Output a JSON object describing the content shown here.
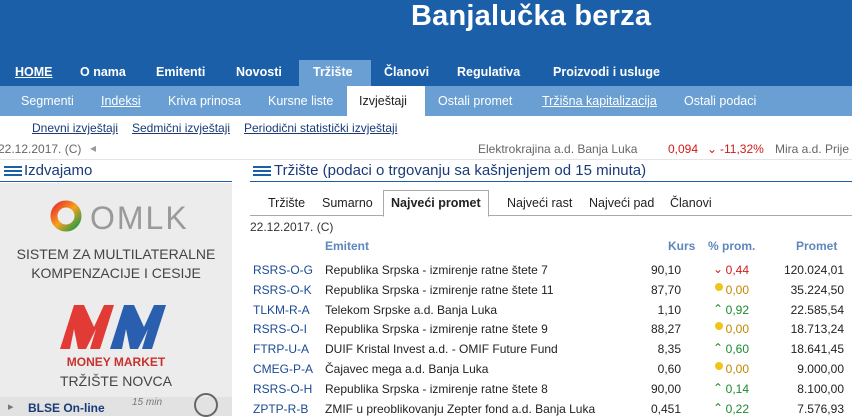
{
  "site": {
    "title": "Banjalučka berza"
  },
  "main_nav": [
    "HOME",
    "O nama",
    "Emitenti",
    "Novosti",
    "Tržište",
    "Članovi",
    "Regulativa",
    "Proizvodi i usluge"
  ],
  "sub_nav": [
    "Segmenti",
    "Indeksi",
    "Kriva prinosa",
    "Kursne liste",
    "Izvještaji",
    "Ostali promet",
    "Tržišna kapitalizacija",
    "Ostali podaci"
  ],
  "tertiary_nav": [
    "Dnevni izvještaji",
    "Sedmični izvještaji",
    "Periodični statistički izvještaji"
  ],
  "ticker": {
    "date": "22.12.2017. (C)",
    "item1_name": "Elektrokrajina a.d. Banja Luka",
    "item1_price": "0,094",
    "item1_change": "-11,32%",
    "item2_name": "Mira a.d. Prije"
  },
  "sidebar": {
    "title": "Izdvajamo",
    "omlk_logo": "OMLK",
    "omlk_text": "SISTEM ZA MULTILATERALNE KOMPENZACIJE I CESIJE",
    "mm_logo": "MONEY MARKET",
    "mm_caption": "TRŽIŠTE NOVCA",
    "bottom_label": "BLSE On-line",
    "bottom_note": "15 min"
  },
  "market": {
    "title": "Tržište (podaci o trgovanju sa kašnjenjem od 15 minuta)",
    "tabs": [
      "Tržište",
      "Sumarno",
      "Najveći promet",
      "Najveći rast",
      "Najveći pad",
      "Članovi"
    ],
    "date": "22.12.2017. (C)",
    "columns": {
      "emitent": "Emitent",
      "kurs": "Kurs",
      "pct": "% prom.",
      "promet": "Promet"
    },
    "rows": [
      {
        "code": "RSRS-O-G",
        "name": "Republika Srpska - izmirenje ratne štete 7",
        "kurs": "90,10",
        "trend": "down",
        "pct": "0,44",
        "promet": "120.024,01"
      },
      {
        "code": "RSRS-O-K",
        "name": "Republika Srpska - izmirenje ratne štete 11",
        "kurs": "87,70",
        "trend": "flat",
        "pct": "0,00",
        "promet": "35.224,50"
      },
      {
        "code": "TLKM-R-A",
        "name": "Telekom Srpske a.d. Banja Luka",
        "kurs": "1,10",
        "trend": "up",
        "pct": "0,92",
        "promet": "22.585,54"
      },
      {
        "code": "RSRS-O-I",
        "name": "Republika Srpska - izmirenje ratne štete 9",
        "kurs": "88,27",
        "trend": "flat",
        "pct": "0,00",
        "promet": "18.713,24"
      },
      {
        "code": "FTRP-U-A",
        "name": "DUIF Kristal Invest a.d. - OMIF Future Fund",
        "kurs": "8,35",
        "trend": "up",
        "pct": "0,60",
        "promet": "18.641,45"
      },
      {
        "code": "CMEG-P-A",
        "name": "Čajavec mega a.d. Banja Luka",
        "kurs": "0,60",
        "trend": "flat",
        "pct": "0,00",
        "promet": "9.000,00"
      },
      {
        "code": "RSRS-O-H",
        "name": "Republika Srpska - izmirenje ratne štete 8",
        "kurs": "90,00",
        "trend": "up",
        "pct": "0,14",
        "promet": "8.100,00"
      },
      {
        "code": "ZPTP-R-B",
        "name": "ZMIF u preoblikovanju Zepter fond a.d. Banja Luka",
        "kurs": "0,451",
        "trend": "up",
        "pct": "0,22",
        "promet": "7.576,93"
      }
    ]
  },
  "colors": {
    "header": "#1a5fa8",
    "subnav": "#6a9fd4",
    "up": "#1c8a2e",
    "down": "#d31a1a",
    "flat": "#f0c419"
  }
}
